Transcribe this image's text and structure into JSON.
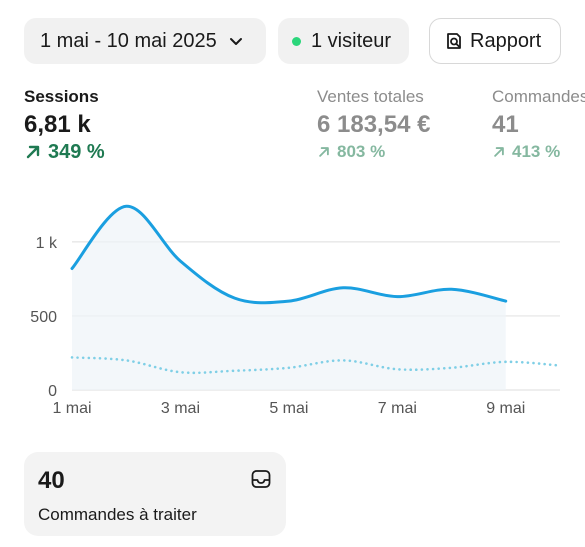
{
  "toolbar": {
    "date_range": "1 mai - 10 mai 2025",
    "visitors": "1 visiteur",
    "report_label": "Rapport",
    "live_dot_color": "#2bd67b"
  },
  "metrics": [
    {
      "label": "Sessions",
      "value": "6,81 k",
      "delta": "349 %"
    },
    {
      "label": "Ventes totales",
      "value": "6 183,54 €",
      "delta": "803 %"
    },
    {
      "label": "Commandes",
      "value": "41",
      "delta": "413 %"
    }
  ],
  "chart_data": {
    "type": "line",
    "x": [
      "1 mai",
      "2 mai",
      "3 mai",
      "4 mai",
      "5 mai",
      "6 mai",
      "7 mai",
      "8 mai",
      "9 mai",
      "10 mai"
    ],
    "xtick_labels": [
      "1 mai",
      "3 mai",
      "5 mai",
      "7 mai",
      "9 mai"
    ],
    "ytick_labels": [
      "0",
      "500",
      "1 k"
    ],
    "ylim": [
      0,
      1350
    ],
    "grid": true,
    "series": [
      {
        "values": [
          820,
          1240,
          870,
          620,
          600,
          690,
          630,
          680,
          600
        ],
        "color": "#1a9fe0",
        "style": "solid"
      },
      {
        "values": [
          220,
          200,
          120,
          130,
          150,
          200,
          140,
          150,
          190,
          165
        ],
        "color": "#7fcfe6",
        "style": "dotted"
      }
    ]
  },
  "card": {
    "count": "40",
    "label": "Commandes à traiter",
    "icon": "inbox-icon"
  }
}
